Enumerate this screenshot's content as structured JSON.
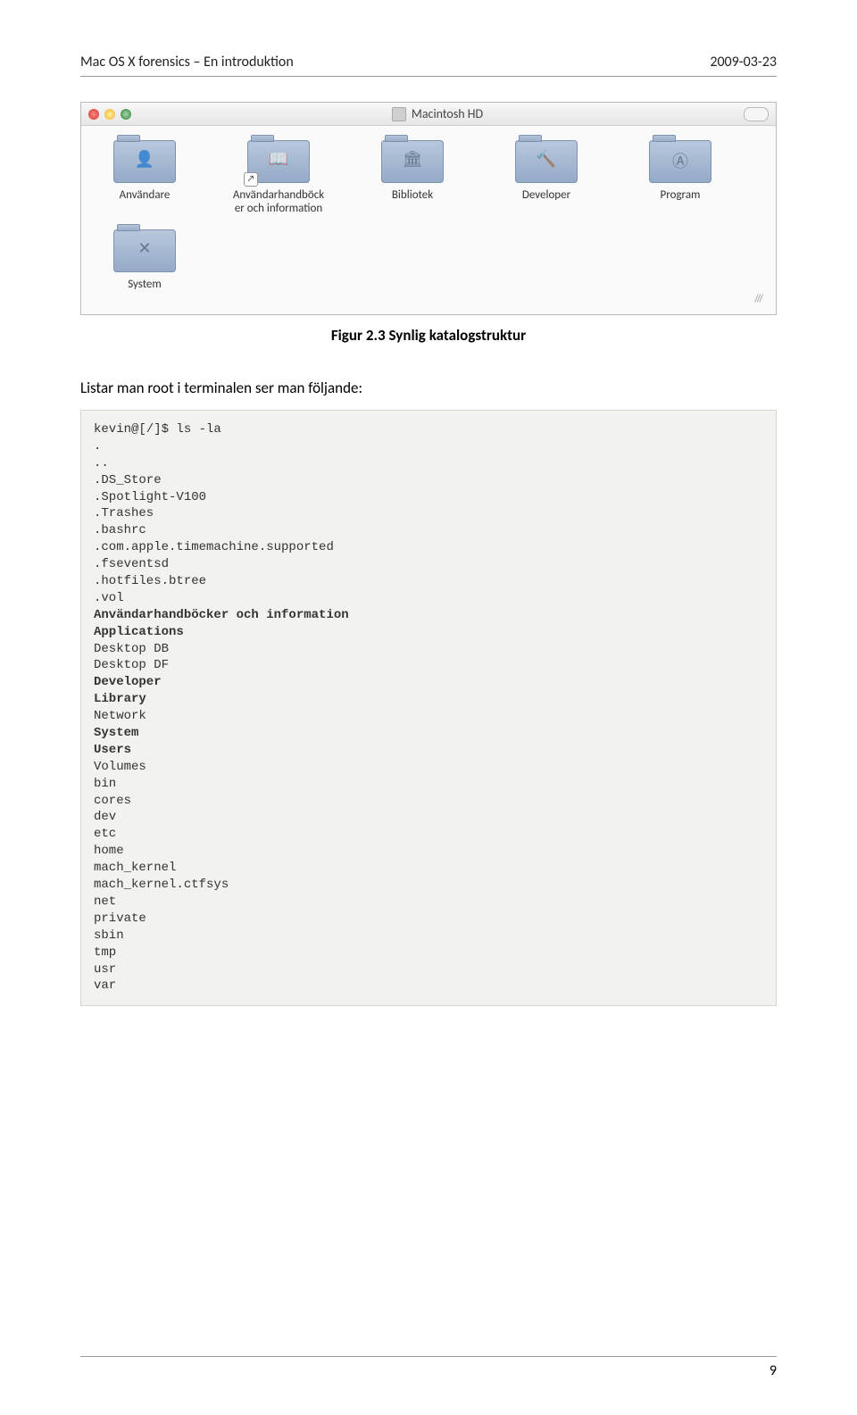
{
  "header": {
    "left": "Mac OS X forensics – En introduktion",
    "right": "2009-03-23"
  },
  "window": {
    "title": "Macintosh HD",
    "items": [
      {
        "label": "Användare",
        "glyph": "👤",
        "badge": false
      },
      {
        "label": "Användarhandböck\ner och information",
        "glyph": "📖",
        "badge": true
      },
      {
        "label": "Bibliotek",
        "glyph": "🏛",
        "badge": false
      },
      {
        "label": "Developer",
        "glyph": "🔨",
        "badge": false
      },
      {
        "label": "Program",
        "glyph": "Ⓐ",
        "badge": false
      },
      {
        "label": "System",
        "glyph": "✕",
        "badge": false
      }
    ]
  },
  "caption": "Figur 2.3 Synlig katalogstruktur",
  "intro": "Listar man root i terminalen ser man följande:",
  "terminal": {
    "prompt": "kevin@[/]$ ls -la",
    "lines": [
      ".",
      "..",
      ".DS_Store",
      ".Spotlight-V100",
      ".Trashes",
      ".bashrc",
      ".com.apple.timemachine.supported",
      ".fseventsd",
      ".hotfiles.btree",
      ".vol"
    ],
    "bold1": "Användarhandböcker och information",
    "bold2": "Applications",
    "lines2": [
      "Desktop DB",
      "Desktop DF"
    ],
    "bold3": "Developer",
    "bold4": "Library",
    "lines3": [
      "Network"
    ],
    "bold5": "System",
    "bold6": "Users",
    "lines4": [
      "Volumes",
      "bin",
      "cores",
      "dev",
      "etc",
      "home",
      "mach_kernel",
      "mach_kernel.ctfsys",
      "net",
      "private",
      "sbin",
      "tmp",
      "usr",
      "var"
    ]
  },
  "footer": {
    "pagenum": "9"
  }
}
